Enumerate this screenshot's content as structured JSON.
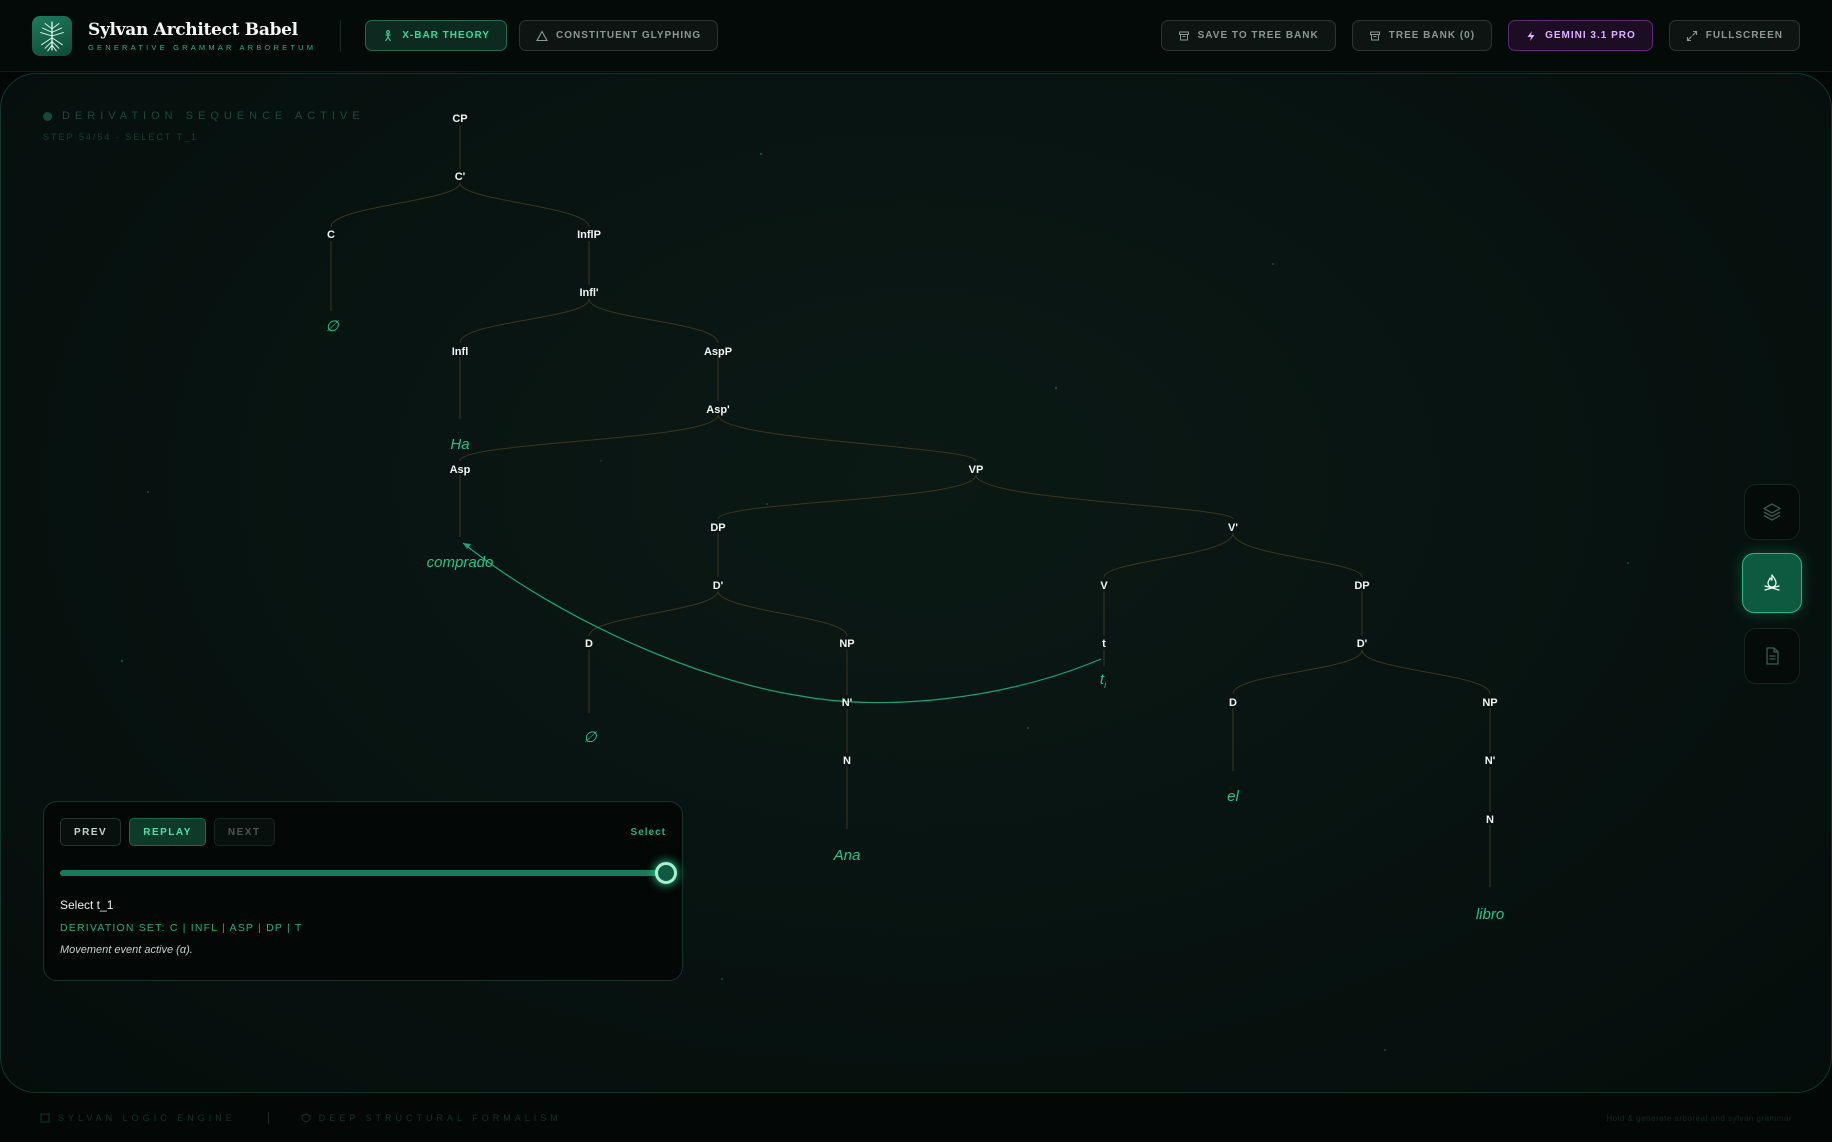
{
  "app": {
    "title": "Sylvan Architect Babel",
    "subtitle": "GENERATIVE GRAMMAR ARBORETUM"
  },
  "header": {
    "mode_tabs": [
      {
        "label": "X-BAR THEORY",
        "icon": "person-tree-icon",
        "active": true
      },
      {
        "label": "CONSTITUENT GLYPHING",
        "icon": "triangle-icon",
        "active": false
      }
    ],
    "actions": [
      {
        "label": "SAVE TO TREE BANK",
        "icon": "archive-icon"
      },
      {
        "label": "TREE BANK (0)",
        "icon": "archive-icon"
      },
      {
        "label": "GEMINI 3.1 PRO",
        "icon": "bolt-icon"
      },
      {
        "label": "FULLSCREEN",
        "icon": "expand-icon"
      }
    ]
  },
  "canvas": {
    "status": "DERIVATION SEQUENCE ACTIVE",
    "step": "STEP 54/54 · SELECT T_1"
  },
  "tree": {
    "nodes": [
      "CP",
      "C'",
      "C",
      "InflP",
      "Infl'",
      "Infl",
      "AspP",
      "Asp'",
      "Asp",
      "VP",
      "DP",
      "V'",
      "D'",
      "V",
      "DP",
      "D",
      "NP",
      "t",
      "D'",
      "N'",
      "D",
      "NP",
      "N",
      "N'",
      "N"
    ],
    "leaves": [
      "∅",
      "Ha",
      "comprado",
      "∅",
      "Ana",
      "t",
      "el",
      "libro"
    ],
    "trace_subscript": "i"
  },
  "controls": {
    "prev": "PREV",
    "replay": "REPLAY",
    "next": "NEXT",
    "mode": "Select",
    "progress": 1.0,
    "step_label": "Select t_1",
    "derivation_set": "DERIVATION SET: C | INFL | ASP | DP | T",
    "description": "Movement event active (α)."
  },
  "side_tools": [
    {
      "icon": "layers-icon",
      "active": false
    },
    {
      "icon": "campfire-icon",
      "active": true
    },
    {
      "icon": "document-icon",
      "active": false
    }
  ],
  "footer": {
    "left": "SYLVAN LOGIC ENGINE",
    "right": "DEEP STRUCTURAL FORMALISM",
    "note": "Hold & generate arboreal and sylvan grammar"
  },
  "colors": {
    "accent": "#22b37f",
    "leaf": "#1fc58a",
    "gemini": "#e2b0ff",
    "edge": "#3b3621"
  }
}
